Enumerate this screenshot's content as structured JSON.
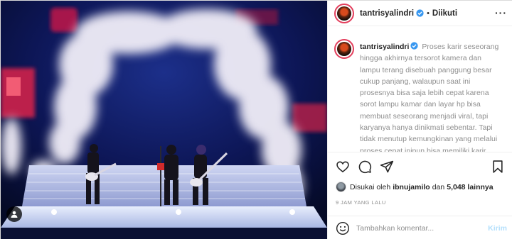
{
  "post": {
    "username": "tantrisyalindri",
    "follow_separator": "•",
    "follow_status": "Diikuti",
    "more_icon": "more-horizontal-icon",
    "caption_text": "Proses karir seseorang hingga akhirnya tersorot kamera dan lampu terang disebuah panggung besar cukup panjang, walaupun saat ini prosesnya bisa saja lebih cepat karena sorot lampu kamar dan layar hp bisa membuat seseorang menjadi viral, tapi karyanya hanya dinikmati sebentar. Tapi tidak menutup kemungkinan yang melalui proses cepat inipun bisa memiliki karir yang panjang karena dia cukup cerdas",
    "likes": {
      "prefix": "Disukai oleh",
      "liker": "ibnujamilo",
      "connector": "dan",
      "count": "5,048 lainnya"
    },
    "timestamp": "9 JAM YANG LALU",
    "comment": {
      "placeholder": "Tambahkan komentar...",
      "submit_label": "Kirim"
    }
  },
  "icons": {
    "actions": [
      "heart-icon",
      "comment-icon",
      "share-icon",
      "bookmark-icon"
    ],
    "photo_overlay": "user-tag-icon",
    "comment_emoji": "emoji-smile-icon"
  },
  "colors": {
    "text": "#262626",
    "secondary": "#8e8e8e",
    "verified": "#3897f0",
    "story_ring": "#e33e5c",
    "submit_disabled": "#b2dffc"
  }
}
